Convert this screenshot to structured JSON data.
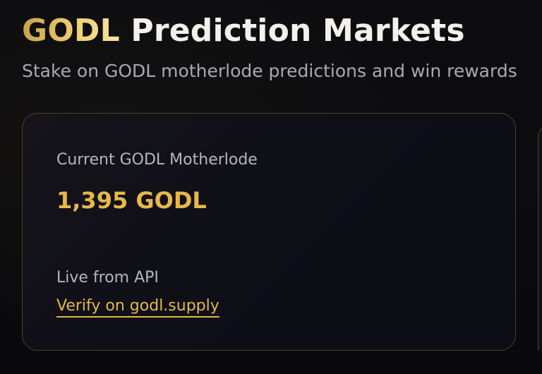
{
  "header": {
    "title_accent": "GODL",
    "title_rest": "Prediction Markets",
    "subtitle": "Stake on GODL motherlode predictions and win rewards"
  },
  "motherlode_card": {
    "label": "Current GODL Motherlode",
    "value": "1,395 GODL",
    "source": "Live from API",
    "verify_link": "Verify on godl.supply"
  },
  "colors": {
    "background": "#0b0b0d",
    "accent_gold": "#e6b846",
    "card_border": "#4a4128",
    "muted_text": "#a9a9b1"
  }
}
